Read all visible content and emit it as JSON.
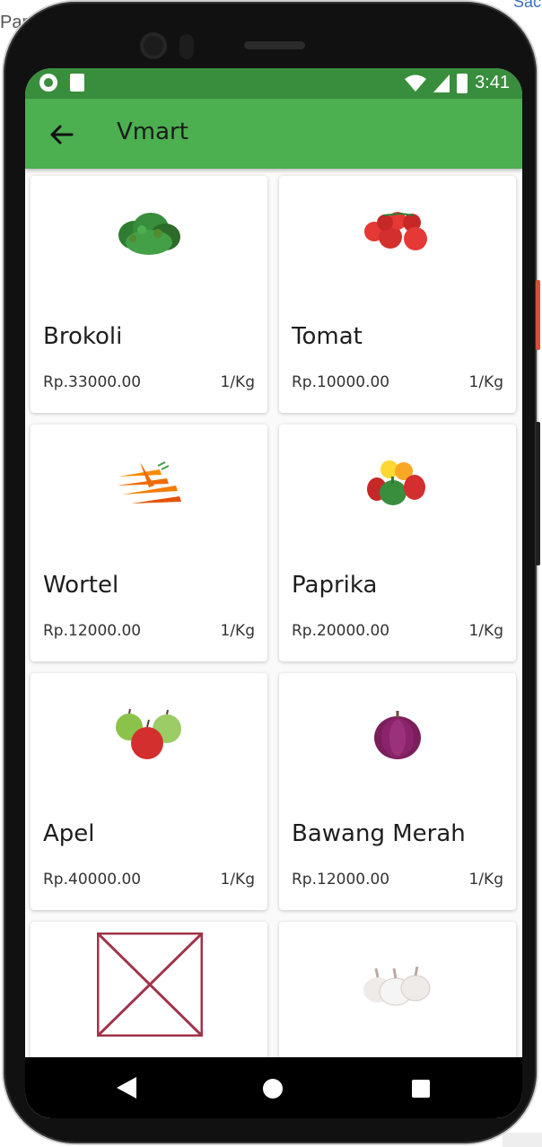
{
  "background": {
    "left_text": "Par",
    "right_text": "Sac"
  },
  "status_bar": {
    "time": "3:41"
  },
  "app_bar": {
    "title": "Vmart"
  },
  "products": [
    {
      "name": "Brokoli",
      "price": "Rp.33000.00",
      "unit": "1/Kg",
      "icon": "broccoli-image"
    },
    {
      "name": "Tomat",
      "price": "Rp.10000.00",
      "unit": "1/Kg",
      "icon": "tomato-image"
    },
    {
      "name": "Wortel",
      "price": "Rp.12000.00",
      "unit": "1/Kg",
      "icon": "carrot-image"
    },
    {
      "name": "Paprika",
      "price": "Rp.20000.00",
      "unit": "1/Kg",
      "icon": "paprika-image"
    },
    {
      "name": "Apel",
      "price": "Rp.40000.00",
      "unit": "1/Kg",
      "icon": "apple-image"
    },
    {
      "name": "Bawang Merah",
      "price": "Rp.12000.00",
      "unit": "1/Kg",
      "icon": "red-onion-image"
    },
    {
      "name": "",
      "price": "",
      "unit": "",
      "icon": "broken-image"
    },
    {
      "name": "",
      "price": "",
      "unit": "",
      "icon": "garlic-image"
    }
  ],
  "colors": {
    "status_bar": "#388e3c",
    "app_bar": "#4caf50",
    "broken_image": "#a0344a"
  }
}
